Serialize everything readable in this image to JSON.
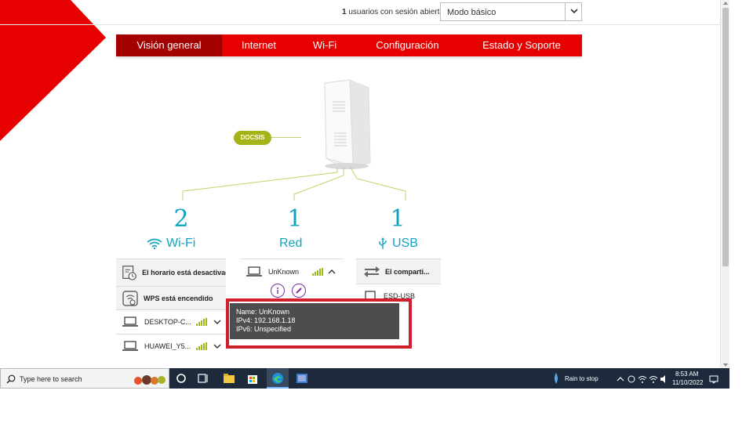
{
  "topbar": {
    "session_count": "1",
    "session_text": "usuarios con sesión abierta",
    "mode_value": "Modo básico"
  },
  "nav": {
    "tabs": [
      {
        "label": "Visión general",
        "active": true
      },
      {
        "label": "Internet",
        "active": false
      },
      {
        "label": "Wi-Fi",
        "active": false
      },
      {
        "label": "Configuración",
        "active": false
      },
      {
        "label": "Estado y Soporte",
        "active": false
      }
    ]
  },
  "diagram": {
    "badge": "DOCSIS"
  },
  "wifi": {
    "count": "2",
    "label": "Wi-Fi",
    "rows": [
      {
        "label": "El horario está desactivado",
        "icon": "schedule-icon"
      },
      {
        "label": "WPS está encendido",
        "icon": "wps-icon"
      },
      {
        "label": "DESKTOP-C...",
        "icon": "laptop-icon"
      },
      {
        "label": "HUAWEI_Y5...",
        "icon": "laptop-icon"
      }
    ]
  },
  "red": {
    "count": "1",
    "label": "Red",
    "device": "UnKnown"
  },
  "usb": {
    "count": "1",
    "label": "USB",
    "rows": [
      {
        "label": "El comparti..."
      },
      {
        "label": "ESD-USB"
      }
    ]
  },
  "tooltip": {
    "name": "Name: UnKnown",
    "ipv4": "IPv4: 192.168.1.18",
    "ipv6": "IPv6: Unspecified"
  },
  "taskbar": {
    "search_placeholder": "Type here to search",
    "weather": "Rain to stop",
    "time": "8:53 AM",
    "date": "11/10/2022"
  },
  "colors": {
    "brand_red": "#e60000",
    "active_tab": "#a30000",
    "accent_teal": "#11a3bf",
    "signal_green": "#9bbb1c",
    "highlight": "#d0202d"
  }
}
